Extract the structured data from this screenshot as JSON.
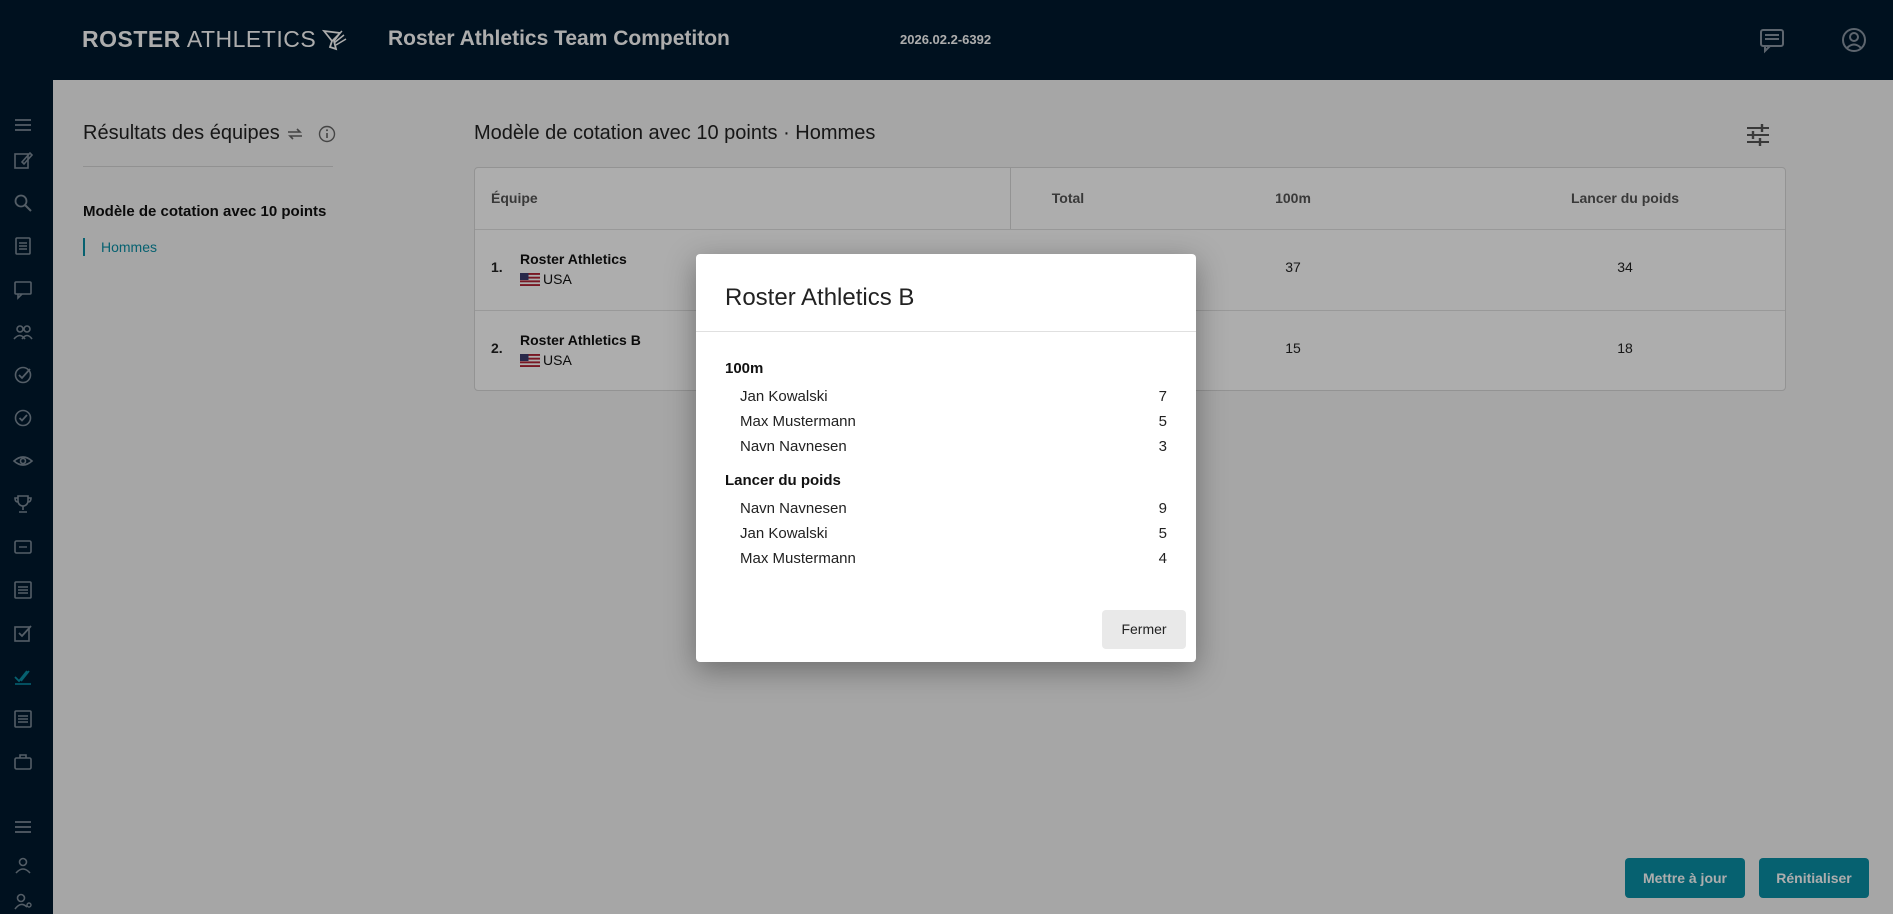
{
  "header": {
    "logo_bold": "ROSTER",
    "logo_light": "ATHLETICS",
    "title": "Roster Athletics Team Competiton",
    "version": "2026.02.2-6392",
    "chat_icon": "chat-icon",
    "user_icon": "account-icon"
  },
  "sidebar": {
    "icons": [
      "menu-icon",
      "edit-icon",
      "search-icon",
      "document-icon",
      "chat-icon",
      "people-icon",
      "check-circle-icon",
      "check-circle-icon",
      "eye-icon",
      "trophy-icon",
      "badge-icon",
      "list-icon",
      "checkbox-icon",
      "teams-check-icon",
      "document-icon",
      "briefcase-icon",
      "menu-icon",
      "person-icon",
      "person-settings-icon"
    ]
  },
  "left_panel": {
    "title": "Résultats des équipes",
    "group": "Modèle de cotation avec 10 points",
    "item": "Hommes"
  },
  "results": {
    "title": "Modèle de cotation avec 10 points · Hommes",
    "columns": {
      "team": "Équipe",
      "total": "Total",
      "event1": "100m",
      "event2": "Lancer du poids"
    },
    "rows": [
      {
        "rank": "1.",
        "team": "Roster Athletics",
        "country": "USA",
        "total": "",
        "event1": "37",
        "event2": "34"
      },
      {
        "rank": "2.",
        "team": "Roster Athletics B",
        "country": "USA",
        "total": "",
        "event1": "15",
        "event2": "18"
      }
    ]
  },
  "buttons": {
    "update": "Mettre à jour",
    "reset": "Rénitialiser"
  },
  "dialog": {
    "title": "Roster Athletics B",
    "sections": [
      {
        "event": "100m",
        "athletes": [
          {
            "name": "Jan Kowalski",
            "points": "7"
          },
          {
            "name": "Max Mustermann",
            "points": "5"
          },
          {
            "name": "Navn Navnesen",
            "points": "3"
          }
        ]
      },
      {
        "event": "Lancer du poids",
        "athletes": [
          {
            "name": "Navn Navnesen",
            "points": "9"
          },
          {
            "name": "Jan Kowalski",
            "points": "5"
          },
          {
            "name": "Max Mustermann",
            "points": "4"
          }
        ]
      }
    ],
    "close": "Fermer"
  },
  "colors": {
    "navy": "#001a2e",
    "accent": "#0a8fa6"
  }
}
